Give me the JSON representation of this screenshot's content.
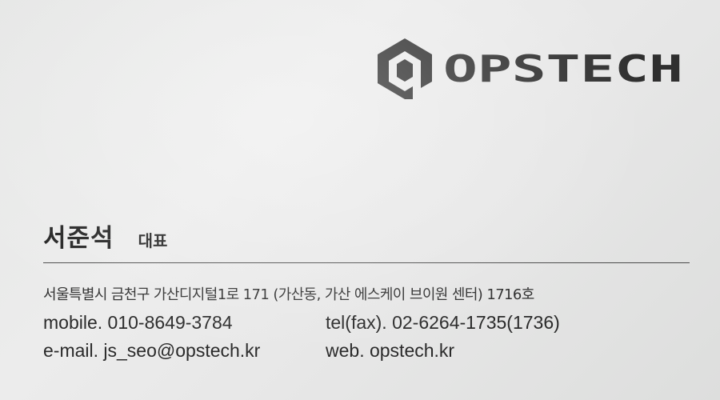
{
  "logo": {
    "wordmark": "OPSTECH",
    "icon": "hexagon-p-logo-icon",
    "color": "#2f2f2f"
  },
  "person": {
    "name": "서준석",
    "title": "대표"
  },
  "address": "서울특별시 금천구 가산디지털1로 171 (가산동, 가산 에스케이 브이원 센터) 1716호",
  "contacts": {
    "mobile": "mobile. 010-8649-3784",
    "tel": "tel(fax). 02-6264-1735(1736)",
    "email": "e-mail. js_seo@opstech.kr",
    "web": "web. opstech.kr"
  },
  "colors": {
    "card": "#e8e8e8",
    "ink": "#2a2a2a",
    "rule": "#4a4a4a"
  }
}
